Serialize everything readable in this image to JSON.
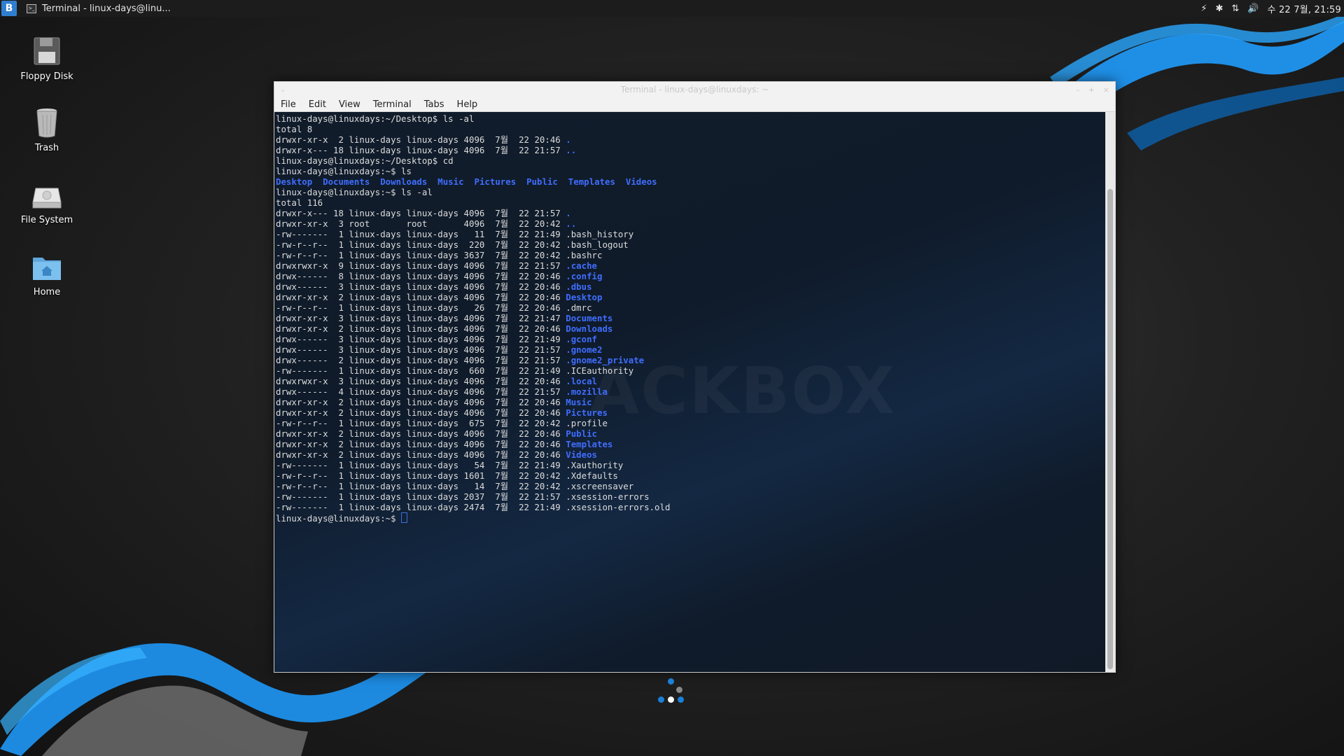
{
  "panel": {
    "menu_glyph": "B",
    "task_title": "Terminal - linux-days@linu...",
    "tray": {
      "power_icon": "⚡",
      "bluetooth_icon": "✱",
      "network_icon": "⇅",
      "volume_icon": "🔊"
    },
    "clock": "수 22 7월, 21:59"
  },
  "desktop_icons": [
    {
      "label": "Floppy Disk",
      "icon": "floppy-disk-icon"
    },
    {
      "label": "Trash",
      "icon": "trash-icon"
    },
    {
      "label": "File System",
      "icon": "drive-icon"
    },
    {
      "label": "Home",
      "icon": "home-folder-icon"
    }
  ],
  "window": {
    "title": "Terminal - linux-days@linuxdays: ~",
    "menu_glyph": "⌄",
    "controls": {
      "minimize": "–",
      "maximize": "+",
      "close": "×"
    },
    "menu": [
      "File",
      "Edit",
      "View",
      "Terminal",
      "Tabs",
      "Help"
    ]
  },
  "wallpaper": {
    "watermark": "ACKBOX"
  },
  "terminal": {
    "colors": {
      "directory": "#3f6dff",
      "text": "#dcdcdc"
    },
    "lines": [
      [
        {
          "t": "linux-days@linuxdays:~/Desktop$ ls -al"
        }
      ],
      [
        {
          "t": "total 8"
        }
      ],
      [
        {
          "t": "drwxr-xr-x  2 linux-days linux-days 4096  7월  22 20:46 "
        },
        {
          "t": ".",
          "d": true
        }
      ],
      [
        {
          "t": "drwxr-x--- 18 linux-days linux-days 4096  7월  22 21:57 "
        },
        {
          "t": "..",
          "d": true
        }
      ],
      [
        {
          "t": "linux-days@linuxdays:~/Desktop$ cd"
        }
      ],
      [
        {
          "t": "linux-days@linuxdays:~$ ls"
        }
      ],
      [
        {
          "t": "Desktop",
          "d": true
        },
        {
          "t": "  "
        },
        {
          "t": "Documents",
          "d": true
        },
        {
          "t": "  "
        },
        {
          "t": "Downloads",
          "d": true
        },
        {
          "t": "  "
        },
        {
          "t": "Music",
          "d": true
        },
        {
          "t": "  "
        },
        {
          "t": "Pictures",
          "d": true
        },
        {
          "t": "  "
        },
        {
          "t": "Public",
          "d": true
        },
        {
          "t": "  "
        },
        {
          "t": "Templates",
          "d": true
        },
        {
          "t": "  "
        },
        {
          "t": "Videos",
          "d": true
        }
      ],
      [
        {
          "t": "linux-days@linuxdays:~$ ls -al"
        }
      ],
      [
        {
          "t": "total 116"
        }
      ],
      [
        {
          "t": "drwxr-x--- 18 linux-days linux-days 4096  7월  22 21:57 "
        },
        {
          "t": ".",
          "d": true
        }
      ],
      [
        {
          "t": "drwxr-xr-x  3 root       root       4096  7월  22 20:42 "
        },
        {
          "t": "..",
          "d": true
        }
      ],
      [
        {
          "t": "-rw-------  1 linux-days linux-days   11  7월  22 21:49 .bash_history"
        }
      ],
      [
        {
          "t": "-rw-r--r--  1 linux-days linux-days  220  7월  22 20:42 .bash_logout"
        }
      ],
      [
        {
          "t": "-rw-r--r--  1 linux-days linux-days 3637  7월  22 20:42 .bashrc"
        }
      ],
      [
        {
          "t": "drwxrwxr-x  9 linux-days linux-days 4096  7월  22 21:57 "
        },
        {
          "t": ".cache",
          "d": true
        }
      ],
      [
        {
          "t": "drwx------  8 linux-days linux-days 4096  7월  22 20:46 "
        },
        {
          "t": ".config",
          "d": true
        }
      ],
      [
        {
          "t": "drwx------  3 linux-days linux-days 4096  7월  22 20:46 "
        },
        {
          "t": ".dbus",
          "d": true
        }
      ],
      [
        {
          "t": "drwxr-xr-x  2 linux-days linux-days 4096  7월  22 20:46 "
        },
        {
          "t": "Desktop",
          "d": true
        }
      ],
      [
        {
          "t": "-rw-r--r--  1 linux-days linux-days   26  7월  22 20:46 .dmrc"
        }
      ],
      [
        {
          "t": "drwxr-xr-x  3 linux-days linux-days 4096  7월  22 21:47 "
        },
        {
          "t": "Documents",
          "d": true
        }
      ],
      [
        {
          "t": "drwxr-xr-x  2 linux-days linux-days 4096  7월  22 20:46 "
        },
        {
          "t": "Downloads",
          "d": true
        }
      ],
      [
        {
          "t": "drwx------  3 linux-days linux-days 4096  7월  22 21:49 "
        },
        {
          "t": ".gconf",
          "d": true
        }
      ],
      [
        {
          "t": "drwx------  3 linux-days linux-days 4096  7월  22 21:57 "
        },
        {
          "t": ".gnome2",
          "d": true
        }
      ],
      [
        {
          "t": "drwx------  2 linux-days linux-days 4096  7월  22 21:57 "
        },
        {
          "t": ".gnome2_private",
          "d": true
        }
      ],
      [
        {
          "t": "-rw-------  1 linux-days linux-days  660  7월  22 21:49 .ICEauthority"
        }
      ],
      [
        {
          "t": "drwxrwxr-x  3 linux-days linux-days 4096  7월  22 20:46 "
        },
        {
          "t": ".local",
          "d": true
        }
      ],
      [
        {
          "t": "drwx------  4 linux-days linux-days 4096  7월  22 21:57 "
        },
        {
          "t": ".mozilla",
          "d": true
        }
      ],
      [
        {
          "t": "drwxr-xr-x  2 linux-days linux-days 4096  7월  22 20:46 "
        },
        {
          "t": "Music",
          "d": true
        }
      ],
      [
        {
          "t": "drwxr-xr-x  2 linux-days linux-days 4096  7월  22 20:46 "
        },
        {
          "t": "Pictures",
          "d": true
        }
      ],
      [
        {
          "t": "-rw-r--r--  1 linux-days linux-days  675  7월  22 20:42 .profile"
        }
      ],
      [
        {
          "t": "drwxr-xr-x  2 linux-days linux-days 4096  7월  22 20:46 "
        },
        {
          "t": "Public",
          "d": true
        }
      ],
      [
        {
          "t": "drwxr-xr-x  2 linux-days linux-days 4096  7월  22 20:46 "
        },
        {
          "t": "Templates",
          "d": true
        }
      ],
      [
        {
          "t": "drwxr-xr-x  2 linux-days linux-days 4096  7월  22 20:46 "
        },
        {
          "t": "Videos",
          "d": true
        }
      ],
      [
        {
          "t": "-rw-------  1 linux-days linux-days   54  7월  22 21:49 .Xauthority"
        }
      ],
      [
        {
          "t": "-rw-r--r--  1 linux-days linux-days 1601  7월  22 20:42 .Xdefaults"
        }
      ],
      [
        {
          "t": "-rw-r--r--  1 linux-days linux-days   14  7월  22 20:42 .xscreensaver"
        }
      ],
      [
        {
          "t": "-rw-------  1 linux-days linux-days 2037  7월  22 21:57 .xsession-errors"
        }
      ],
      [
        {
          "t": "-rw-------  1 linux-days linux-days 2474  7월  22 21:49 .xsession-errors.old"
        }
      ]
    ],
    "prompt": "linux-days@linuxdays:~$ "
  }
}
